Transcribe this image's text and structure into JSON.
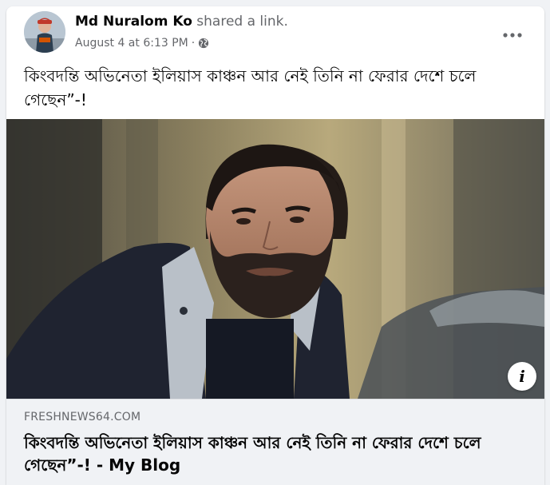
{
  "post": {
    "author": "Md Nuralom Ko",
    "action": "shared a link.",
    "timestamp": "August 4 at 6:13 PM",
    "separator": "·",
    "privacy_icon": "globe-icon",
    "more_icon": "more-options-icon",
    "text": "কিংবদন্তি অভিনেতা ইলিয়াস কাঞ্চন আর নেই তিনি না ফেরার দেশে চলে গেছেন”-!"
  },
  "link": {
    "domain": "FRESHNEWS64.COM",
    "title": "কিংবদন্তি অভিনেতা ইলিয়াস কাঞ্চন আর নেই তিনি না ফেরার দেশে চলে গেছেন”-! - My Blog",
    "info_label": "i",
    "info_icon": "info-icon"
  },
  "colors": {
    "text_primary": "#050505",
    "text_secondary": "#65676b",
    "background": "#f0f2f5",
    "card": "#ffffff"
  }
}
